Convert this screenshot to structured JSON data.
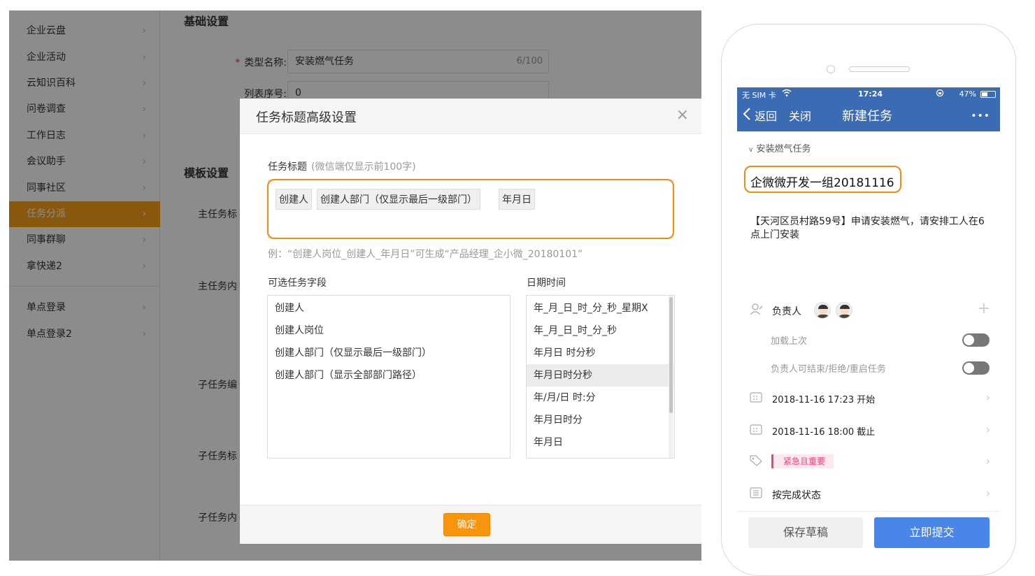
{
  "sidebar": {
    "items": [
      {
        "label": "企业云盘"
      },
      {
        "label": "企业活动"
      },
      {
        "label": "云知识百科"
      },
      {
        "label": "问卷调查"
      },
      {
        "label": "工作日志"
      },
      {
        "label": "会议助手"
      },
      {
        "label": "同事社区"
      },
      {
        "label": "任务分派"
      },
      {
        "label": "同事群聊"
      },
      {
        "label": "拿快递2"
      },
      {
        "label": "单点登录"
      },
      {
        "label": "单点登录2"
      }
    ],
    "active_index": 7,
    "chevron": "›"
  },
  "content": {
    "basic_title": "基础设置",
    "type_name_label": "类型名称:",
    "required_mark": "*",
    "type_name_value": "安装燃气任务",
    "type_name_count": "6/100",
    "order_label": "列表序号:",
    "order_value": "0",
    "template_title": "模板设置",
    "row_labels": [
      "主任务标",
      "主任务内",
      "子任务编",
      "子任务标",
      "子任务内"
    ]
  },
  "modal": {
    "title": "任务标题高级设置",
    "close_icon": "×",
    "task_title_label": "任务标题",
    "task_title_hint": "(微信端仅显示前100字)",
    "tokens": [
      "创建人",
      "创建人部门（仅显示最后一级部门）",
      "年月日"
    ],
    "example": "例：“创建人岗位_创建人_年月日”可生成“产品经理_企小微_20180101”",
    "fields_label": "可选任务字段",
    "fields": [
      "创建人",
      "创建人岗位",
      "创建人部门（仅显示最后一级部门）",
      "创建人部门（显示全部部门路径）"
    ],
    "datetime_label": "日期时间",
    "datetime_options": [
      "年_月_日_时_分_秒_星期X",
      "年_月_日_时_分_秒",
      "年月日 时分秒",
      "年月日时分秒",
      "年/月/日 时:分",
      "年月日时分",
      "年月日"
    ],
    "datetime_selected_index": 3,
    "confirm_label": "确定",
    "accent_color": "#f7950f",
    "highlight_color": "#f08a13"
  },
  "phone": {
    "status": {
      "carrier": "无 SIM 卡",
      "time": "17:24",
      "battery": "47%",
      "battery_level": 0.47
    },
    "nav": {
      "back": "返回",
      "close": "关闭",
      "title": "新建任务",
      "more": "•••"
    },
    "type_label": "安装燃气任务",
    "task_title": "企微微开发一组20181116",
    "task_content": "【天河区员村路59号】申请安装燃气，请安排工人在6点上门安装",
    "owner_label": "负责人",
    "add_icon": "+",
    "load_last_label": "加载上次",
    "owner_can_label": "负责人可结束/拒绝/重启任务",
    "start_time": "2018-11-16 17:23 开始",
    "end_time": "2018-11-16 18:00 截止",
    "priority": "紧急且重要",
    "status_mode": "按完成状态",
    "draft_label": "保存草稿",
    "submit_label": "立即提交",
    "nav_color": "#3b6bb2",
    "submit_color": "#4a86e8",
    "priority_color": "#e8457a"
  }
}
